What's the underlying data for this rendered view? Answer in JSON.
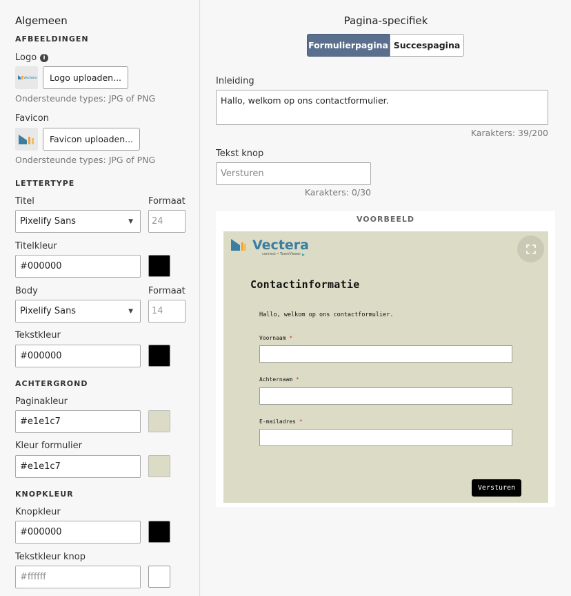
{
  "left": {
    "title": "Algemeen",
    "images_heading": "AFBEELDINGEN",
    "logo_label": "Logo",
    "logo_info_icon": "info-icon",
    "logo_button": "Logo uploaden...",
    "logo_hint": "Ondersteunde types: JPG of PNG",
    "favicon_label": "Favicon",
    "favicon_button": "Favicon uploaden...",
    "favicon_hint": "Ondersteunde types: JPG of PNG",
    "font_heading": "LETTERTYPE",
    "title_label": "Titel",
    "title_size_label": "Formaat",
    "title_font": "Pixelify Sans",
    "title_size": "24",
    "title_color_label": "Titelkleur",
    "title_color_value": "#000000",
    "body_label": "Body",
    "body_size_label": "Formaat",
    "body_font": "Pixelify Sans",
    "body_size": "14",
    "text_color_label": "Tekstkleur",
    "text_color_value": "#000000",
    "background_heading": "ACHTERGROND",
    "page_color_label": "Paginakleur",
    "page_color_value": "#e1e1c7",
    "form_color_label": "Kleur formulier",
    "form_color_value": "#e1e1c7",
    "button_color_heading": "KNOPKLEUR",
    "button_color_label": "Knopkleur",
    "button_color_value": "#000000",
    "button_text_color_label": "Tekstkleur knop",
    "button_text_color_placeholder": "#ffffff"
  },
  "right": {
    "title": "Pagina-specifiek",
    "tabs": [
      "Formulierpagina",
      "Succespagina"
    ],
    "intro_label": "Inleiding",
    "intro_value": "Hallo, welkom op ons  contactformulier.",
    "intro_counter": "Karakters: 39/200",
    "button_text_label": "Tekst knop",
    "button_text_placeholder": "Versturen",
    "button_text_counter": "Karakters: 0/30",
    "preview_title": "VOORBEELD",
    "preview": {
      "logo_text": "Vectera",
      "logo_sub": "connect • TeamViewer",
      "heading": "Contactinformatie",
      "intro": "Hallo, welkom op ons contactformulier.",
      "fields": [
        "Voornaam",
        "Achternaam",
        "E-mailadres"
      ],
      "required_mark": "*",
      "submit": "Versturen",
      "expand_icon": "expand-icon"
    }
  },
  "colors": {
    "tab_active": "#5a6f8d",
    "page_color": "#e1e1c7",
    "black": "#000000",
    "white": "#ffffff",
    "logo_blue": "#3b7ea1",
    "logo_orange": "#f0a030"
  }
}
